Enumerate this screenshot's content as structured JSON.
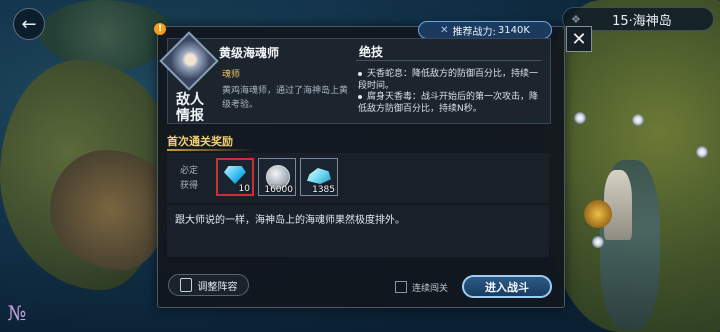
{
  "header": {
    "chapter_label": "15·海神岛",
    "back_icon": "back-arrow-icon"
  },
  "dialog": {
    "power_label": "推荐战力:",
    "power_value": "3140K",
    "enemy_tag": "敌人情报",
    "enemy": {
      "name": "黄级海魂师",
      "class": "魂师",
      "description": "黄鸡海魂师，通过了海神岛上黄级考验。"
    },
    "skills": {
      "title": "绝技",
      "items": [
        "天香蛇息：降低敌方的防御百分比，持续一段时间。",
        "腐身天香毒：战斗开始后的第一次攻击，降低敌方防御百分比，持续N秒。"
      ]
    },
    "rewards": {
      "title": "首次通关奖励",
      "label": "必定获得",
      "items": [
        {
          "icon": "diamond-icon",
          "qty": "10",
          "selected": true
        },
        {
          "icon": "silver-coin-icon",
          "qty": "16000",
          "selected": false
        },
        {
          "icon": "crystal-icon",
          "qty": "1385",
          "selected": false
        }
      ]
    },
    "dialogue": "跟大师说的一样，海神岛上的海魂师果然极度排外。",
    "buttons": {
      "adjust_lineup": "调整阵容",
      "auto_battle": "连续闯关",
      "enter_battle": "进入战斗"
    }
  },
  "colors": {
    "accent": "#9ccdf4",
    "reward_title": "#f0d070",
    "class_text": "#e8c866",
    "selected_border": "#c83232"
  }
}
